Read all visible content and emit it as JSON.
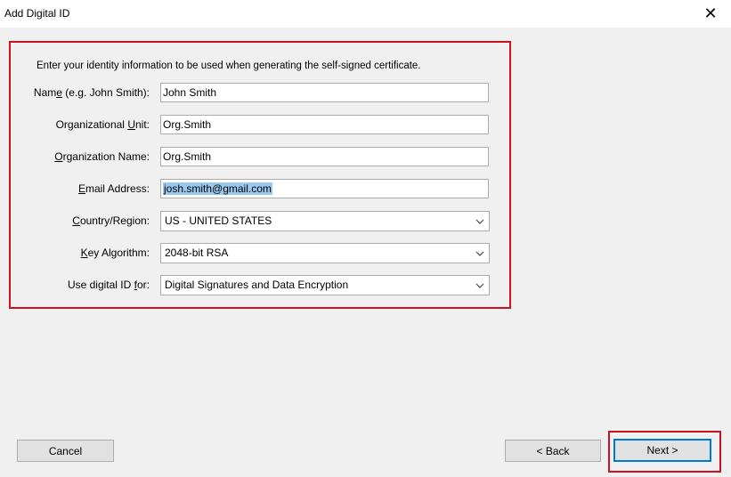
{
  "window": {
    "title": "Add Digital ID",
    "close_glyph": "✕"
  },
  "form": {
    "intro": "Enter your identity information to be used when generating the self-signed certificate.",
    "fields": [
      {
        "label_pre": "Nam",
        "label_mn": "e",
        "label_post": " (e.g. John Smith):",
        "value": "John Smith"
      },
      {
        "label_pre": "Organizational ",
        "label_mn": "U",
        "label_post": "nit:",
        "value": "Org.Smith"
      },
      {
        "label_pre": "",
        "label_mn": "O",
        "label_post": "rganization Name:",
        "value": "Org.Smith"
      },
      {
        "label_pre": "",
        "label_mn": "E",
        "label_post": "mail Address:",
        "value": "josh.smith@gmail.com"
      }
    ],
    "selects": [
      {
        "label_pre": "",
        "label_mn": "C",
        "label_post": "ountry/Region:",
        "value": "US - UNITED STATES"
      },
      {
        "label_pre": "",
        "label_mn": "K",
        "label_post": "ey Algorithm:",
        "value": "2048-bit RSA"
      },
      {
        "label_pre": "Use digital ID ",
        "label_mn": "f",
        "label_post": "or:",
        "value": "Digital Signatures and Data Encryption"
      }
    ]
  },
  "buttons": {
    "cancel": "Cancel",
    "back": "< Back",
    "next": "Next >"
  },
  "colors": {
    "highlight_border": "#d0111b",
    "focus_border": "#0078d7",
    "selection": "#99c9ef"
  }
}
